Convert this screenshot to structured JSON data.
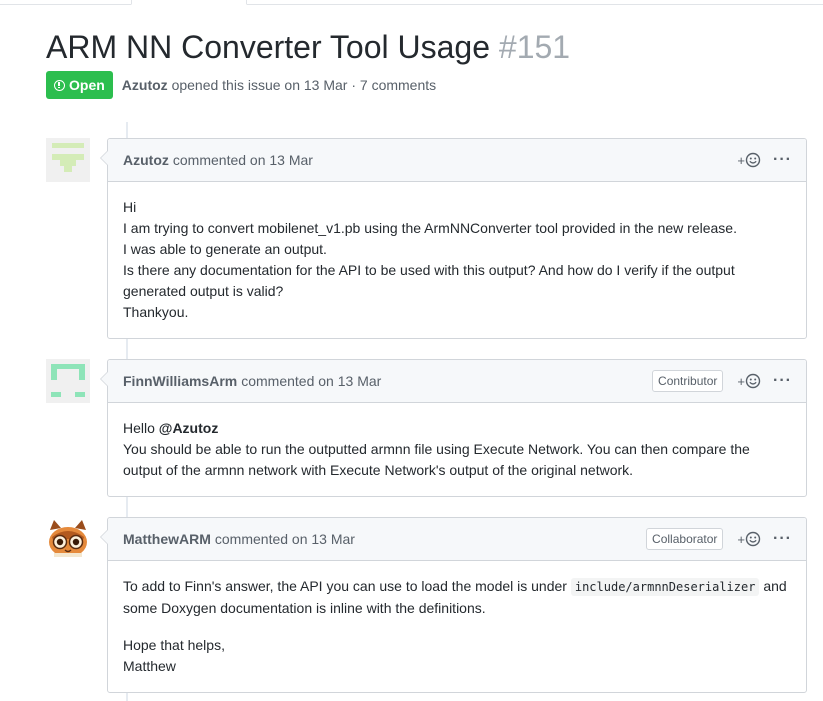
{
  "issue": {
    "title": "ARM NN Converter Tool Usage",
    "number": "#151",
    "state": "Open",
    "author": "Azutoz",
    "meta_rest": "opened this issue on 13 Mar · 7 comments"
  },
  "comments": [
    {
      "author": "Azutoz",
      "when": "commented on 13 Mar",
      "badge": "",
      "body": [
        "Hi",
        "I am trying to convert mobilenet_v1.pb using the ArmNNConverter tool provided in the new release.",
        "I was able to generate an output.",
        "Is there any documentation for the API to be used with this output? And how do I verify if the output generated output is valid?",
        "Thankyou."
      ]
    },
    {
      "author": "FinnWilliamsArm",
      "when": "commented on 13 Mar",
      "badge": "Contributor",
      "greeting": "Hello",
      "mention": "@Azutoz",
      "body_line": "You should be able to run the outputted armnn file using Execute Network. You can then compare the output of the armnn network with Execute Network's output of the original network."
    },
    {
      "author": "MatthewARM",
      "when": "commented on 13 Mar",
      "badge": "Collaborator",
      "p1_before": "To add to Finn's answer, the API you can use to load the model is under",
      "p1_code": "include/armnnDeserializer",
      "p1_after": "and some Doxygen documentation is inline with the definitions.",
      "p2_line1": "Hope that helps,",
      "p2_line2": "Matthew"
    }
  ],
  "actions": {
    "plus": "+",
    "more": "···",
    "reaction_icon": "smiley-icon",
    "more_icon": "kebab-horizontal-icon"
  },
  "colors": {
    "open_green": "#2cbe4e",
    "avatar_azutoz": "#d4ecb7",
    "avatar_finn": "#8ee4b8"
  }
}
